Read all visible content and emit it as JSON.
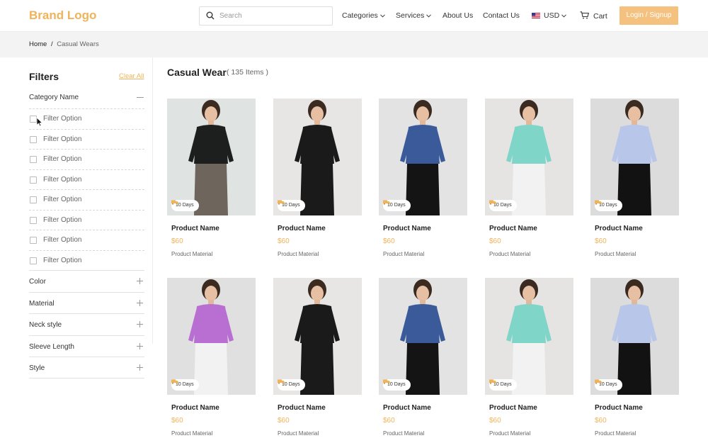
{
  "header": {
    "brand": "Brand Logo",
    "search_placeholder": "Search",
    "nav": [
      "Categories",
      "Services",
      "About Us",
      "Contact Us"
    ],
    "currency": "USD",
    "cart": "Cart",
    "login": "Login / Signup"
  },
  "breadcrumb": {
    "home": "Home",
    "sep": "/",
    "current": "Casual Wears"
  },
  "filters": {
    "title": "Filters",
    "clear_all": "Clear All",
    "category_title": "Category Name",
    "options": [
      "Filter Option",
      "Filter Option",
      "Filter Option",
      "Filter Option",
      "Filter Option",
      "Filter Option",
      "Filter Option",
      "Filter Option"
    ],
    "groups": [
      "Color",
      "Material",
      "Neck style",
      "Sleeve Length",
      "Style"
    ]
  },
  "main": {
    "title": "Casual Wear",
    "count": "( 135 Items )"
  },
  "products": [
    {
      "name": "Product Name",
      "price": "$60",
      "material": "Product Material",
      "badge": "10 Days",
      "top": "#1c1f1d",
      "bottom": "#6e655c",
      "bg": "#dfe3e2"
    },
    {
      "name": "Product Name",
      "price": "$60",
      "material": "Product Material",
      "badge": "10 Days",
      "top": "#1a1a1a",
      "bottom": "#1a1a1a",
      "bg": "#e7e6e4"
    },
    {
      "name": "Product Name",
      "price": "$60",
      "material": "Product Material",
      "badge": "10 Days",
      "top": "#3a5a9a",
      "bottom": "#141414",
      "bg": "#e4e3e3"
    },
    {
      "name": "Product Name",
      "price": "$60",
      "material": "Product Material",
      "badge": "10 Days",
      "top": "#7fd6c8",
      "bottom": "#f2f2f2",
      "bg": "#e5e4e3"
    },
    {
      "name": "Product Name",
      "price": "$60",
      "material": "Product Material",
      "badge": "10 Days",
      "top": "#b8c6ea",
      "bottom": "#121212",
      "bg": "#dcdcdc"
    },
    {
      "name": "Product Name",
      "price": "$60",
      "material": "Product Material",
      "badge": "10 Days",
      "top": "#b86fd1",
      "bottom": "#f2f2f2",
      "bg": "#e0e0e0"
    },
    {
      "name": "Product Name",
      "price": "$60",
      "material": "Product Material",
      "badge": "10 Days",
      "top": "#1a1a1a",
      "bottom": "#1a1a1a",
      "bg": "#e7e6e4"
    },
    {
      "name": "Product Name",
      "price": "$60",
      "material": "Product Material",
      "badge": "10 Days",
      "top": "#3a5a9a",
      "bottom": "#141414",
      "bg": "#e4e3e3"
    },
    {
      "name": "Product Name",
      "price": "$60",
      "material": "Product Material",
      "badge": "10 Days",
      "top": "#7fd6c8",
      "bottom": "#f2f2f2",
      "bg": "#e5e4e3"
    },
    {
      "name": "Product Name",
      "price": "$60",
      "material": "Product Material",
      "badge": "10 Days",
      "top": "#b8c6ea",
      "bottom": "#121212",
      "bg": "#dcdcdc"
    }
  ],
  "colors": {
    "accent": "#f0b35a",
    "login_bg": "#f5c17f",
    "breadcrumb_bg": "#f3f3f4"
  },
  "icons": [
    "search-icon",
    "chevron-down-icon",
    "us-flag-icon",
    "cart-icon",
    "minus-icon",
    "plus-icon",
    "delivery-truck-icon",
    "mouse-cursor-icon"
  ]
}
